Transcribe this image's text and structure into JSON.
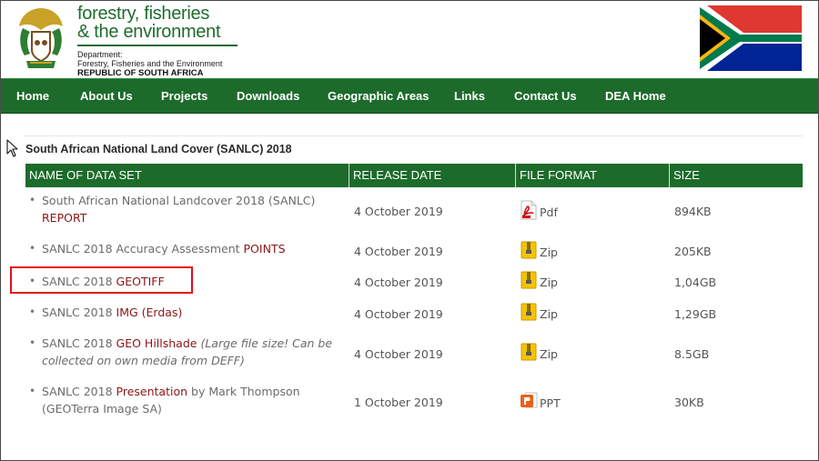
{
  "header": {
    "brand_line1": "forestry, fisheries",
    "brand_line2": "& the environment",
    "dept_label": "Department:",
    "dept_name": "Forestry, Fisheries and the Environment",
    "country": "REPUBLIC OF SOUTH AFRICA"
  },
  "nav": {
    "items": [
      {
        "label": "Home"
      },
      {
        "label": "About Us"
      },
      {
        "label": "Projects"
      },
      {
        "label": "Downloads"
      },
      {
        "label": "Geographic Areas"
      },
      {
        "label": "Links"
      },
      {
        "label": "Contact Us"
      },
      {
        "label": "DEA Home"
      }
    ]
  },
  "section": {
    "title": "South African National Land Cover (SANLC) 2018"
  },
  "table": {
    "headers": [
      "NAME OF DATA SET",
      "RELEASE DATE",
      "FILE FORMAT",
      "SIZE"
    ],
    "rows": [
      {
        "name_prefix": "South African National Landcover 2018 (SANLC) ",
        "link": "REPORT",
        "name_suffix": "",
        "note": "",
        "note_suffix": "",
        "date": "4 October 2019",
        "format": "Pdf",
        "format_icon": "pdf-icon",
        "size": "894KB"
      },
      {
        "name_prefix": "SANLC 2018 Accuracy Assessment ",
        "link": "POINTS",
        "name_suffix": "",
        "note": "",
        "note_suffix": "",
        "date": "4 October 2019",
        "format": "Zip",
        "format_icon": "zip-icon",
        "size": "205KB"
      },
      {
        "name_prefix": "SANLC 2018 ",
        "link": "GEOTIFF",
        "name_suffix": "",
        "note": "",
        "note_suffix": "",
        "date": "4 October 2019",
        "format": "Zip",
        "format_icon": "zip-icon",
        "size": "1,04GB"
      },
      {
        "name_prefix": "SANLC 2018 ",
        "link": "IMG (Erdas)",
        "name_suffix": "",
        "note": "",
        "note_suffix": "",
        "date": "4 October 2019",
        "format": "Zip",
        "format_icon": "zip-icon",
        "size": "1,29GB"
      },
      {
        "name_prefix": "SANLC 2018 ",
        "link": "GEO Hillshade",
        "name_suffix": " ",
        "note": "(Large file size!",
        "note_suffix": " Can be collected on own media from DEFF)",
        "date": "4 October 2019",
        "format": "Zip",
        "format_icon": "zip-icon",
        "size": "8.5GB"
      },
      {
        "name_prefix": "SANLC 2018 ",
        "link": "Presentation",
        "name_suffix": " by Mark Thompson (GEOTerra Image SA)",
        "note": "",
        "note_suffix": "",
        "date": "1 October 2019",
        "format": "PPT",
        "format_icon": "ppt-icon",
        "size": "30KB"
      }
    ]
  },
  "colors": {
    "brand_green": "#1d6b2b",
    "link_red": "#8a1515",
    "highlight_red": "#e0101a"
  }
}
